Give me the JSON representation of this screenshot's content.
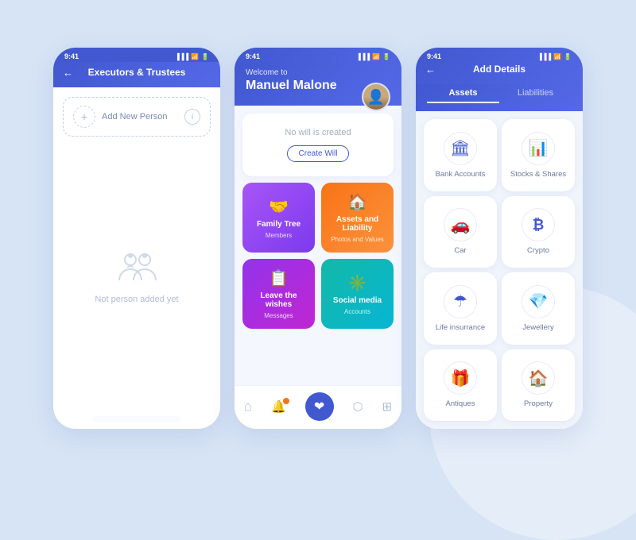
{
  "background": "#d6e4f5",
  "phones": {
    "phone1": {
      "statusBar": {
        "time": "9:41"
      },
      "header": {
        "title": "Executors & Trustees",
        "backArrow": "←"
      },
      "addPerson": {
        "label": "Add New Person",
        "plusIcon": "+",
        "infoIcon": "i"
      },
      "emptyState": {
        "text": "Not person added yet"
      }
    },
    "phone2": {
      "statusBar": {
        "time": "9:41"
      },
      "header": {
        "welcomeTo": "Welcome to",
        "name": "Manuel Malone"
      },
      "willCard": {
        "text": "No will is created",
        "buttonLabel": "Create Will"
      },
      "gridCards": [
        {
          "id": "family",
          "title": "Family Tree",
          "sub": "Members",
          "icon": "🤝"
        },
        {
          "id": "assets",
          "title": "Assets and Liability",
          "sub": "Photos and Values",
          "icon": "🏠"
        },
        {
          "id": "wishes",
          "title": "Leave the wishes",
          "sub": "Messages",
          "icon": "📋"
        },
        {
          "id": "social",
          "title": "Social media",
          "sub": "Accounts",
          "icon": "✳️"
        }
      ],
      "bottomNav": [
        {
          "id": "home",
          "icon": "⌂",
          "active": false
        },
        {
          "id": "bell",
          "icon": "🔔",
          "active": false,
          "badge": true
        },
        {
          "id": "heart",
          "icon": "❤",
          "active": true,
          "center": true
        },
        {
          "id": "share",
          "icon": "⬛",
          "active": false
        },
        {
          "id": "grid",
          "icon": "⊞",
          "active": false
        }
      ]
    },
    "phone3": {
      "statusBar": {
        "time": "9:41"
      },
      "header": {
        "title": "Add Details",
        "backArrow": "←"
      },
      "tabs": [
        {
          "label": "Assets",
          "active": true
        },
        {
          "label": "Liabilities",
          "active": false
        }
      ],
      "assetItems": [
        {
          "id": "bank",
          "label": "Bank Accounts",
          "icon": "🏛"
        },
        {
          "id": "stocks",
          "label": "Stocks & Shares",
          "icon": "📊"
        },
        {
          "id": "car",
          "label": "Car",
          "icon": "🚗"
        },
        {
          "id": "crypto",
          "label": "Crypto",
          "icon": "₿"
        },
        {
          "id": "life",
          "label": "Life insurrance",
          "icon": "☂"
        },
        {
          "id": "jewellery",
          "label": "Jewellery",
          "icon": "💎"
        },
        {
          "id": "antiques",
          "label": "Antiques",
          "icon": "🎁"
        },
        {
          "id": "property",
          "label": "Property",
          "icon": "🏠"
        }
      ]
    }
  }
}
